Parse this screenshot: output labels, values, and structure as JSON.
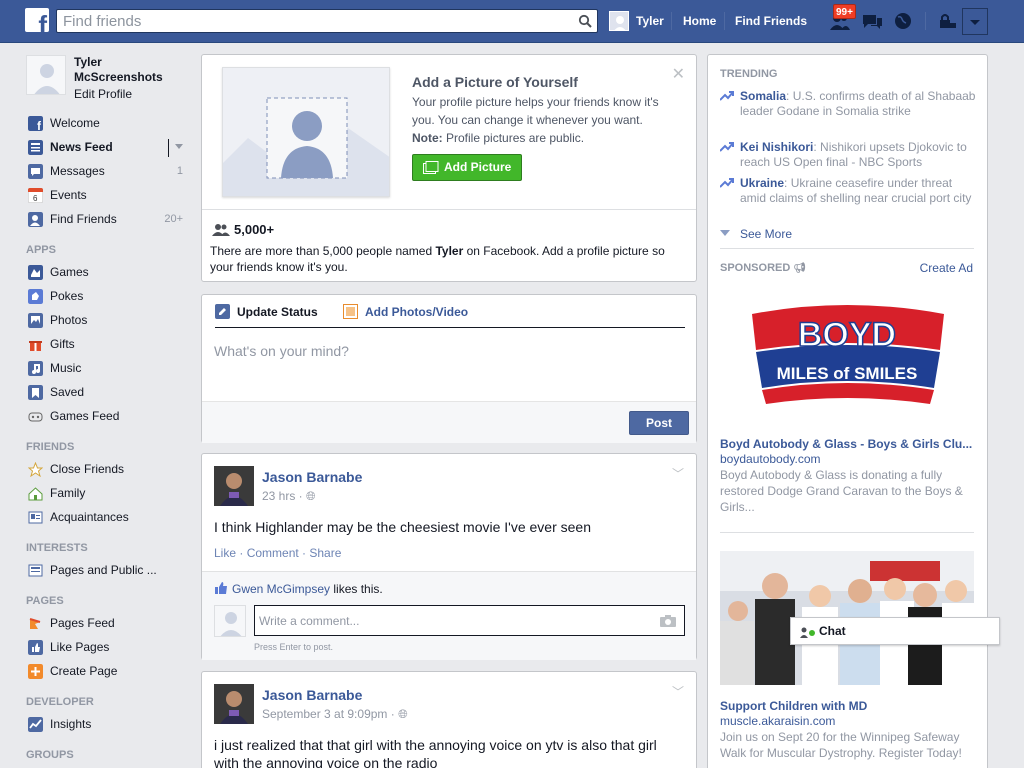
{
  "topbar": {
    "search_placeholder": "Find friends",
    "user_name": "Tyler",
    "home_label": "Home",
    "find_friends_label": "Find Friends",
    "notification_badge": "99+"
  },
  "profile": {
    "name": "Tyler McScreenshots",
    "edit_label": "Edit Profile"
  },
  "leftnav": {
    "main": [
      {
        "label": "Welcome",
        "icon": "facebook-icon",
        "count": ""
      },
      {
        "label": "News Feed",
        "icon": "news-feed-icon",
        "count": ""
      },
      {
        "label": "Messages",
        "icon": "messages-icon",
        "count": "1"
      },
      {
        "label": "Events",
        "icon": "calendar-icon",
        "count": ""
      },
      {
        "label": "Find Friends",
        "icon": "find-friends-icon",
        "count": "20+"
      }
    ],
    "apps_heading": "APPS",
    "apps": [
      {
        "label": "Games",
        "icon": "games-icon"
      },
      {
        "label": "Pokes",
        "icon": "pokes-icon"
      },
      {
        "label": "Photos",
        "icon": "photos-icon"
      },
      {
        "label": "Gifts",
        "icon": "gifts-icon"
      },
      {
        "label": "Music",
        "icon": "music-icon"
      },
      {
        "label": "Saved",
        "icon": "saved-icon"
      },
      {
        "label": "Games Feed",
        "icon": "games-feed-icon"
      }
    ],
    "friends_heading": "FRIENDS",
    "friends": [
      {
        "label": "Close Friends",
        "icon": "star-icon"
      },
      {
        "label": "Family",
        "icon": "family-icon"
      },
      {
        "label": "Acquaintances",
        "icon": "acquaintances-icon"
      }
    ],
    "interests_heading": "INTERESTS",
    "interests": [
      {
        "label": "Pages and Public ...",
        "icon": "pages-list-icon"
      }
    ],
    "pages_heading": "PAGES",
    "pages": [
      {
        "label": "Pages Feed",
        "icon": "pages-feed-icon"
      },
      {
        "label": "Like Pages",
        "icon": "like-icon"
      },
      {
        "label": "Create Page",
        "icon": "create-page-icon"
      }
    ],
    "developer_heading": "DEVELOPER",
    "developer": [
      {
        "label": "Insights",
        "icon": "insights-icon"
      }
    ],
    "groups_heading": "GROUPS"
  },
  "profile_picture_prompt": {
    "title": "Add a Picture of Yourself",
    "description": "Your profile picture helps your friends know it's you. You can change it whenever you want.",
    "note_label": "Note:",
    "note_text": " Profile pictures are public.",
    "button_label": "Add Picture",
    "count": "5,000+",
    "message_prefix": "There are more than 5,000 people named ",
    "message_name": "Tyler",
    "message_suffix": " on Facebook. Add a profile picture so your friends know it's you."
  },
  "composer": {
    "tab_status": "Update Status",
    "tab_photos": "Add Photos/Video",
    "placeholder": "What's on your mind?",
    "post_label": "Post"
  },
  "posts": [
    {
      "author": "Jason Barnabe",
      "time": "23 hrs · ",
      "text": "I think Highlander may be the cheesiest movie I've ever seen",
      "like": "Like",
      "comment": "Comment",
      "share": "Share",
      "liker": "Gwen McGimpsey",
      "likes_suffix": " likes this.",
      "comment_placeholder": "Write a comment...",
      "comment_hint": "Press Enter to post."
    },
    {
      "author": "Jason Barnabe",
      "time": "September 3 at 9:09pm · ",
      "text": "i just realized that that girl with the annoying voice on ytv is also that girl with the annoying voice on the radio"
    }
  ],
  "trending": {
    "heading": "TRENDING",
    "items": [
      {
        "topic": "Somalia",
        "text": ": U.S. confirms death of al Shabaab leader Godane in Somalia strike"
      },
      {
        "topic": "Kei Nishikori",
        "text": ": Nishikori upsets Djokovic to reach US Open final - NBC Sports"
      },
      {
        "topic": "Ukraine",
        "text": ": Ukraine ceasefire under threat amid claims of shelling near crucial port city"
      }
    ],
    "see_more": "See More"
  },
  "sponsored": {
    "heading": "SPONSORED",
    "create_ad": "Create Ad",
    "ads": [
      {
        "logo_top": "BOYD",
        "logo_bottom": "MILES of SMILES",
        "title": "Boyd Autobody & Glass - Boys & Girls Clu...",
        "url": "boydautobody.com",
        "desc": "Boyd Autobody & Glass is donating a fully restored Dodge Grand Caravan to the Boys & Girls..."
      },
      {
        "title": "Support Children with MD",
        "url": "muscle.akaraisin.com",
        "desc": "Join us on Sept 20 for the Winnipeg Safeway Walk for Muscular Dystrophy. Register Today!"
      }
    ]
  },
  "chat": {
    "label": "Chat"
  },
  "colors": {
    "brand": "#3b5998",
    "green": "#42b72a",
    "badge": "#f03d25"
  }
}
